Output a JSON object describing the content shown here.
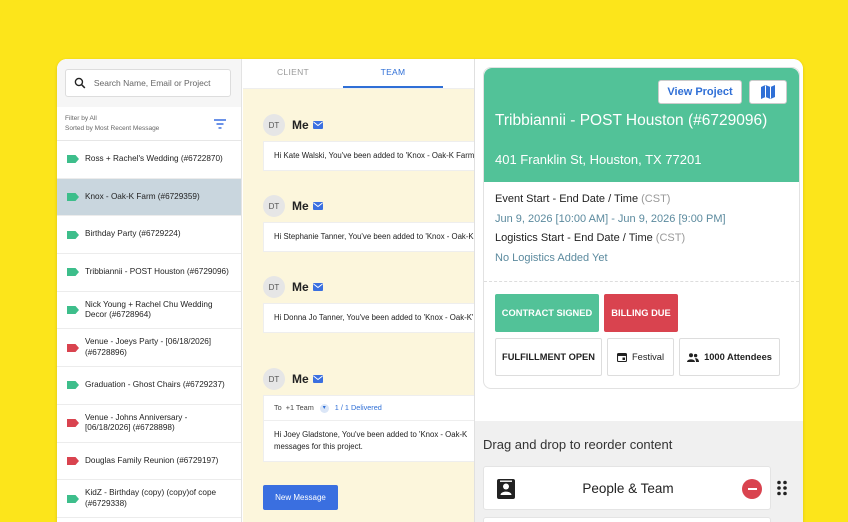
{
  "sidebar": {
    "search_placeholder": "Search Name, Email or Project",
    "filter_line1": "Filter by All",
    "filter_line2": "Sorted by Most Recent Message",
    "items": [
      {
        "label": "Ross + Rachel's Wedding (#6722870)",
        "tag_color": "#3DBE8B"
      },
      {
        "label": "Knox - Oak-K Farm (#6729359)",
        "tag_color": "#3DBE8B"
      },
      {
        "label": "Birthday Party (#6729224)",
        "tag_color": "#3DBE8B"
      },
      {
        "label": "Tribbiannii - POST Houston (#6729096)",
        "tag_color": "#3DBE8B"
      },
      {
        "label": "Nick Young + Rachel Chu Wedding Decor (#6728964)",
        "tag_color": "#3DBE8B"
      },
      {
        "label": "Venue - Joeys Party - [06/18/2026] (#6728896)",
        "tag_color": "#D9434F"
      },
      {
        "label": "Graduation - Ghost Chairs (#6729237)",
        "tag_color": "#3DBE8B"
      },
      {
        "label": "Venue - Johns Anniversary - [06/18/2026] (#6728898)",
        "tag_color": "#D9434F"
      },
      {
        "label": "Douglas Family Reunion (#6729197)",
        "tag_color": "#D9434F"
      },
      {
        "label": "KidZ - Birthday (copy) (copy)of cope (#6729338)",
        "tag_color": "#3DBE8B"
      }
    ]
  },
  "conversation": {
    "tabs": [
      {
        "label": "CLIENT"
      },
      {
        "label": "TEAM"
      }
    ],
    "messages": [
      {
        "initials": "DT",
        "sender": "Me",
        "text": "Hi Kate Walski, You've been added to 'Knox - Oak-K Farm'"
      },
      {
        "initials": "DT",
        "sender": "Me",
        "text": "Hi Stephanie Tanner, You've been added to 'Knox - Oak-K'"
      },
      {
        "initials": "DT",
        "sender": "Me",
        "text": "Hi Donna Jo Tanner, You've been added to 'Knox - Oak-K'"
      },
      {
        "initials": "DT",
        "sender": "Me",
        "to_label": "To",
        "to_value": "+1 Team",
        "delivered": "1 / 1 Delivered",
        "text_line1": "Hi Joey Gladstone, You've been added to 'Knox - Oak-K",
        "text_line2": "messages for this project."
      }
    ],
    "new_message_label": "New Message"
  },
  "project": {
    "view_project_label": "View Project",
    "title": "Tribbiannii - POST Houston (#6729096)",
    "address": "401 Franklin St, Houston, TX 77201",
    "event_label": "Event Start - End Date / Time",
    "event_tz": "(CST)",
    "event_value": "Jun 9, 2026 [10:00 AM] - Jun 9, 2026 [9:00 PM]",
    "logistics_label": "Logistics Start - End Date / Time",
    "logistics_tz": "(CST)",
    "logistics_value": "No Logistics Added Yet",
    "badges": {
      "contract": "CONTRACT SIGNED",
      "billing": "BILLING DUE",
      "fulfillment": "FULFILLMENT OPEN",
      "festival": "Festival",
      "attendees": "1000 Attendees"
    },
    "drag_drop_label": "Drag and drop to reorder content",
    "section_label": "People & Team"
  },
  "colors": {
    "brand_yellow": "#FCE51B",
    "green": "#52C298",
    "red": "#D9434F",
    "blue": "#2F6FD6"
  }
}
